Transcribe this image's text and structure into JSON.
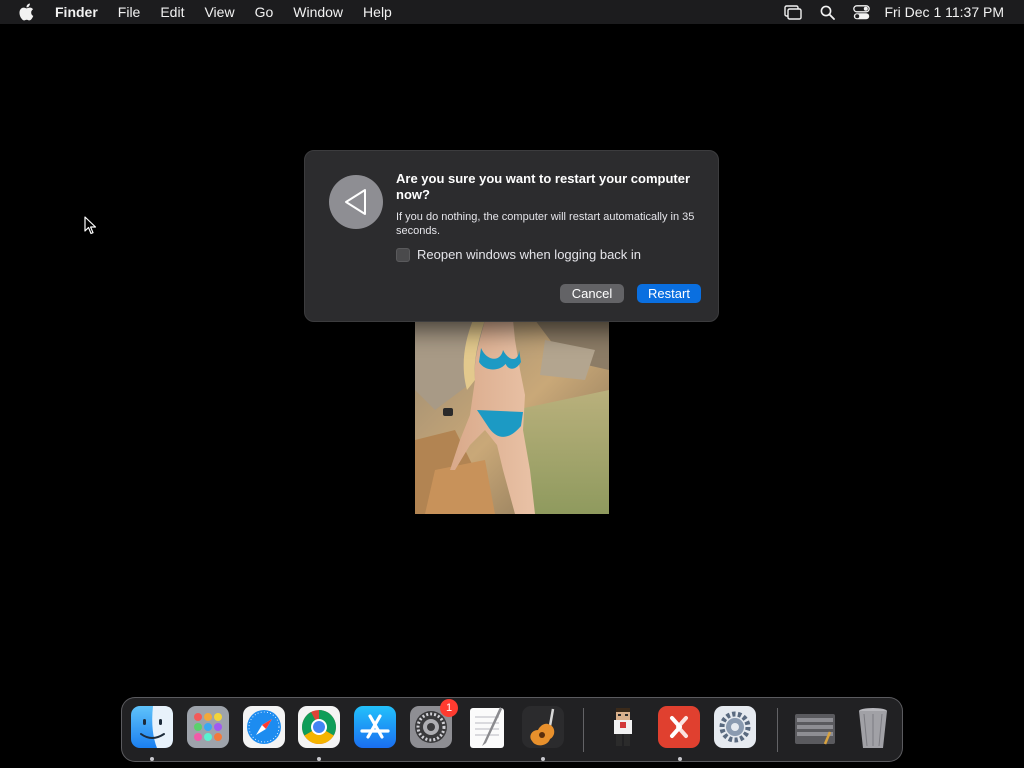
{
  "menubar": {
    "app_name": "Finder",
    "items": [
      "File",
      "Edit",
      "View",
      "Go",
      "Window",
      "Help"
    ],
    "clock": "Fri Dec 1  11:37 PM"
  },
  "dialog": {
    "title": "Are you sure you want to restart your computer now?",
    "body": "If you do nothing, the computer will restart automatically in 35 seconds.",
    "checkbox_label": "Reopen windows when logging back in",
    "checkbox_checked": false,
    "cancel_label": "Cancel",
    "restart_label": "Restart",
    "icon": "restart-triangle-icon"
  },
  "dock": {
    "settings_badge": "1",
    "items": [
      "finder-icon",
      "launchpad-icon",
      "safari-icon",
      "chrome-icon",
      "app-store-icon",
      "system-preferences-icon",
      "textedit-icon",
      "garageband-icon",
      "character-app-icon",
      "remote-desktop-icon",
      "settings-gear-icon",
      "screenshot-folder-icon",
      "trash-icon"
    ]
  },
  "colors": {
    "accent": "#0a6fe0",
    "dialog_bg": "#2c2c2e",
    "badge": "#ff3b30",
    "menubar_bg": "#1c1c1e"
  }
}
